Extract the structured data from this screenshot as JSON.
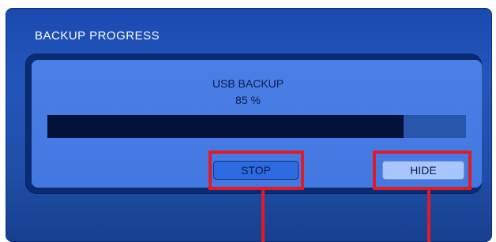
{
  "dialog": {
    "title": "BACKUP PROGRESS",
    "task_name": "USB BACKUP",
    "percent_text": "85 %",
    "progress_fraction": 0.85
  },
  "buttons": {
    "stop_label": "STOP",
    "hide_label": "HIDE"
  },
  "colors": {
    "window_bg": "#2455bb",
    "panel_bg": "#4a80e6",
    "progress_fill": "#03123a",
    "progress_track": "#2956ad",
    "callout": "#e01b24"
  }
}
